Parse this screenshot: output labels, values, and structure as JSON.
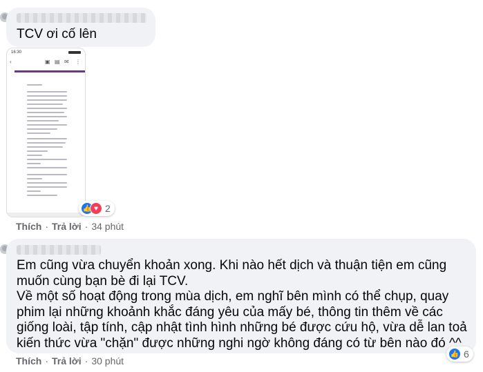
{
  "comments": [
    {
      "id": "c1",
      "text": "TCV ơi cố lên",
      "actions": {
        "like": "Thích",
        "reply": "Trả lời",
        "time": "34 phút"
      },
      "reactions": {
        "count": "2",
        "icons": [
          "like-icon",
          "love-icon"
        ]
      },
      "attachment": {
        "status_time": "16:30"
      }
    },
    {
      "id": "c2",
      "lines": [
        "Em cũng vừa chuyển khoản xong. Khi nào hết dịch và thuận tiện em cũng",
        "muốn cùng bạn bè đi lại TCV.",
        "Về một số hoạt động trong mùa dịch, em nghĩ bên mình có thể chụp, quay",
        "phim lại những khoảnh khắc đáng yêu của mấy bé, thông tin thêm về các",
        "giống loài, tập tính, cập nhật tình hình những bé được cứu hộ, vừa dễ lan toả",
        "kiến thức vừa \"chặn\" được những nghi ngờ không đáng có từ bên nào đó ^^"
      ],
      "actions": {
        "like": "Thích",
        "reply": "Trả lời",
        "time": "30 phút"
      },
      "reactions": {
        "count": "6",
        "icons": [
          "like-icon"
        ]
      }
    }
  ],
  "colors": {
    "bubble": "#f0f2f5",
    "meta": "#65676b",
    "like": "#1877f2",
    "love": "#f33e58",
    "email_header": "#6b3a7a"
  }
}
